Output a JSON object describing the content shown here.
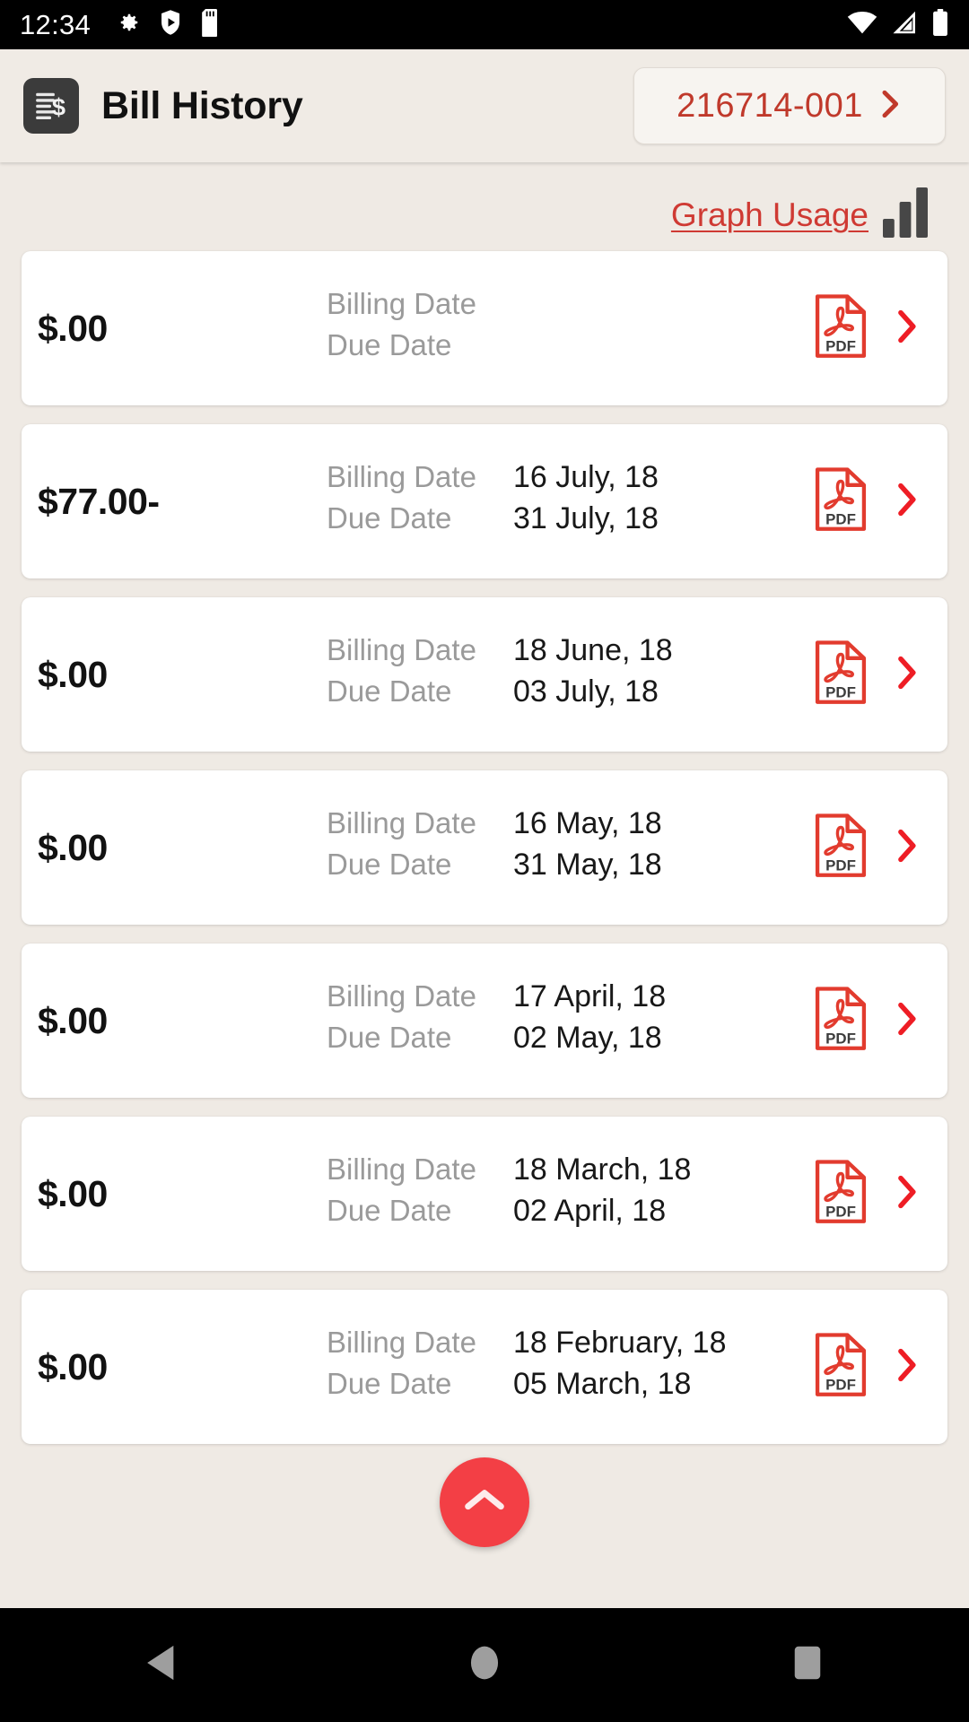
{
  "status_bar": {
    "time": "12:34",
    "left_icons": [
      "gear-icon",
      "shield-play-icon",
      "sd-card-icon"
    ],
    "right_icons": [
      "wifi-icon",
      "cell-signal-icon",
      "battery-icon"
    ]
  },
  "app_bar": {
    "logo_icon": "bill-document-dollar-icon",
    "title": "Bill History",
    "account_number": "216714-001",
    "account_chevron_icon": "chevron-right-icon"
  },
  "toolbar": {
    "graph_usage_label": "Graph Usage",
    "graph_usage_icon": "bar-chart-icon"
  },
  "labels": {
    "billing_date": "Billing Date",
    "due_date": "Due Date",
    "pdf_icon": "pdf-file-icon",
    "row_chevron_icon": "chevron-right-icon"
  },
  "bills": [
    {
      "amount": "$.00",
      "billing_date": "",
      "due_date": ""
    },
    {
      "amount": "$77.00-",
      "billing_date": "16 July, 18",
      "due_date": "31 July, 18"
    },
    {
      "amount": "$.00",
      "billing_date": "18 June, 18",
      "due_date": "03 July, 18"
    },
    {
      "amount": "$.00",
      "billing_date": "16 May, 18",
      "due_date": "31 May, 18"
    },
    {
      "amount": "$.00",
      "billing_date": "17 April, 18",
      "due_date": "02 May, 18"
    },
    {
      "amount": "$.00",
      "billing_date": "18 March, 18",
      "due_date": "02 April, 18"
    },
    {
      "amount": "$.00",
      "billing_date": "18 February, 18",
      "due_date": "05 March, 18"
    }
  ],
  "fab": {
    "icon": "chevron-up-icon"
  },
  "nav_bar": {
    "back_icon": "triangle-back-icon",
    "home_icon": "circle-home-icon",
    "recents_icon": "square-recents-icon"
  },
  "colors": {
    "accent_red": "#cf3a33",
    "fab_red": "#f33f45",
    "background": "#efeae4",
    "card": "#ffffff",
    "label_gray": "#9a9a9a"
  }
}
